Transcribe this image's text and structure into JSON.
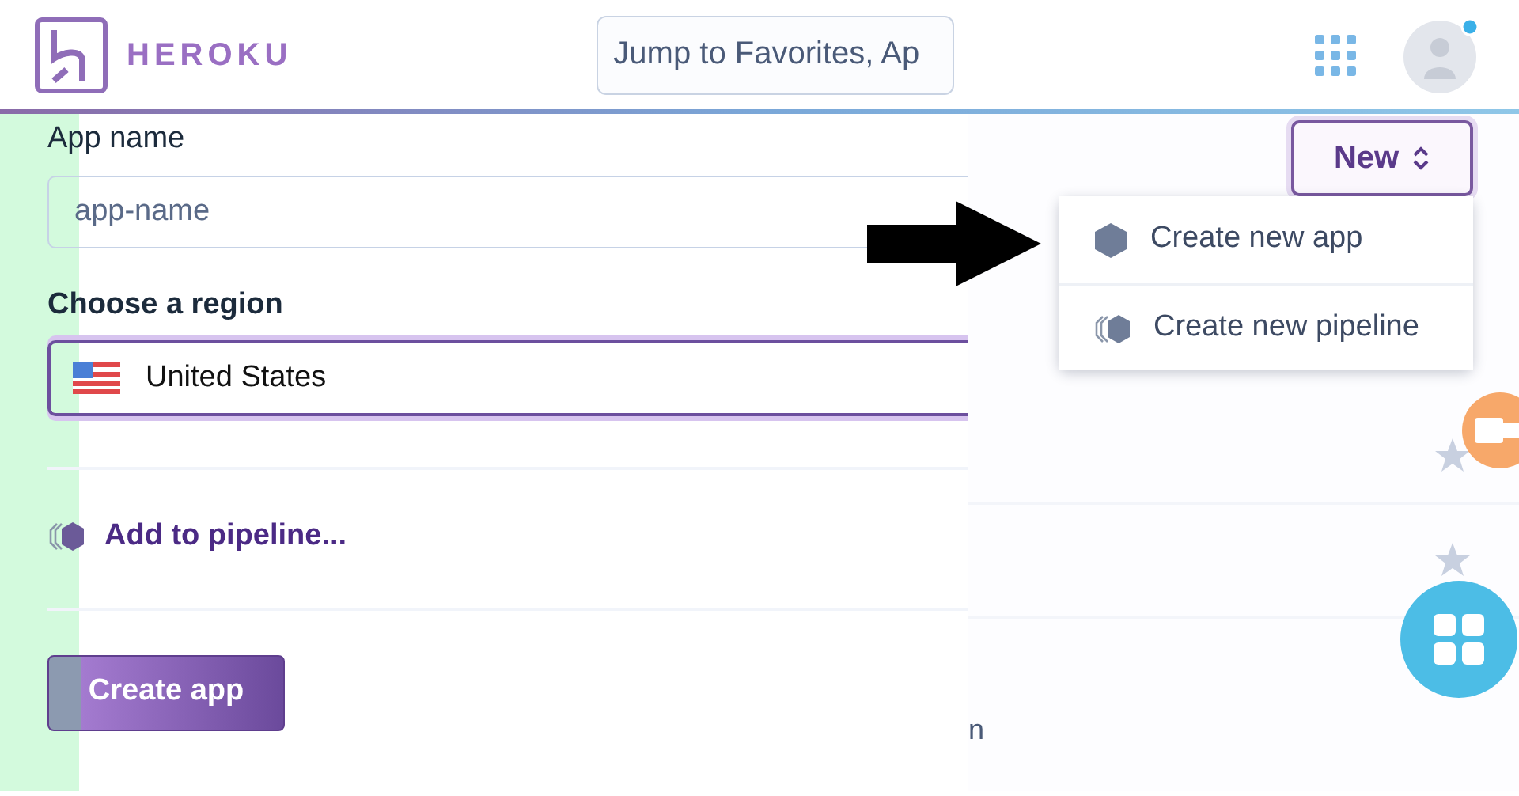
{
  "header": {
    "brand": "HEROKU",
    "search": {
      "placeholder": "Jump to Favorites, Ap"
    },
    "notification": true
  },
  "form": {
    "app_name": {
      "label": "App name",
      "placeholder": "app-name"
    },
    "region": {
      "label": "Choose a region",
      "value": "United States"
    },
    "pipeline_link": "Add to pipeline...",
    "submit": "Create app"
  },
  "new_button": {
    "label": "New",
    "expanded": true
  },
  "menu": [
    {
      "label": "Create new app",
      "kind": "app"
    },
    {
      "label": "Create new pipeline",
      "kind": "pipeline"
    }
  ],
  "list_rows": [
    {
      "starred": false
    },
    {
      "starred": false
    }
  ],
  "fragment": "n"
}
